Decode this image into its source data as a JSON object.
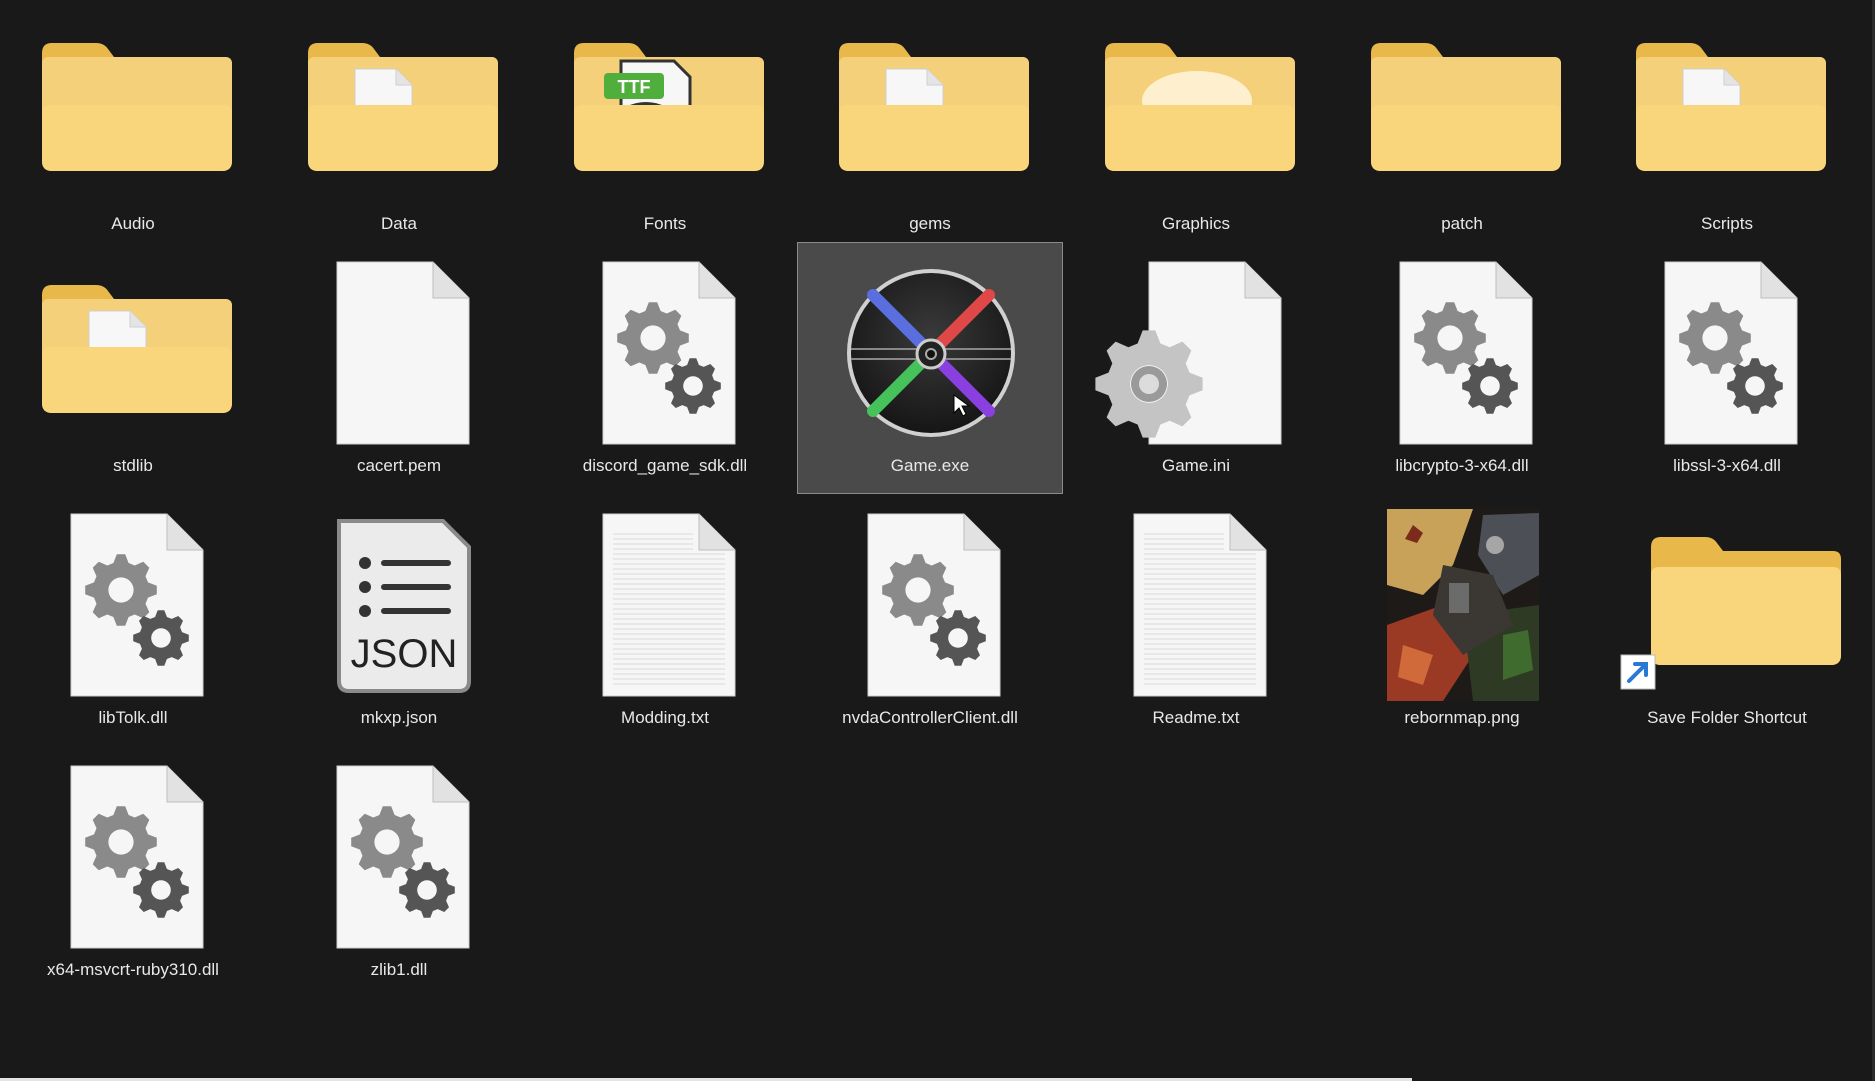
{
  "window": {
    "background": "#191919",
    "selected_background": "#4a4a4a"
  },
  "files": [
    {
      "name": "Audio",
      "type": "folder",
      "icon": "folder-icon",
      "overlay": "none"
    },
    {
      "name": "Data",
      "type": "folder",
      "icon": "folder-icon",
      "overlay": "doc"
    },
    {
      "name": "Fonts",
      "type": "folder",
      "icon": "folder-icon",
      "overlay": "ttf",
      "badge": "TTF"
    },
    {
      "name": "gems",
      "type": "folder",
      "icon": "folder-icon",
      "overlay": "doc"
    },
    {
      "name": "Graphics",
      "type": "folder",
      "icon": "folder-icon",
      "overlay": "glow"
    },
    {
      "name": "patch",
      "type": "folder",
      "icon": "folder-icon",
      "overlay": "none"
    },
    {
      "name": "Scripts",
      "type": "folder",
      "icon": "folder-icon",
      "overlay": "doc"
    },
    {
      "name": "stdlib",
      "type": "folder",
      "icon": "folder-icon",
      "overlay": "doc"
    },
    {
      "name": "cacert.pem",
      "type": "blank",
      "icon": "blank-file-icon"
    },
    {
      "name": "discord_game_sdk.dll",
      "type": "dll",
      "icon": "dll-file-icon"
    },
    {
      "name": "Game.exe",
      "type": "exe",
      "icon": "game-exe-icon",
      "selected": true
    },
    {
      "name": "Game.ini",
      "type": "ini",
      "icon": "ini-file-icon"
    },
    {
      "name": "libcrypto-3-x64.dll",
      "type": "dll",
      "icon": "dll-file-icon"
    },
    {
      "name": "libssl-3-x64.dll",
      "type": "dll",
      "icon": "dll-file-icon"
    },
    {
      "name": "libTolk.dll",
      "type": "dll",
      "icon": "dll-file-icon"
    },
    {
      "name": "mkxp.json",
      "type": "json",
      "icon": "json-file-icon",
      "badge": "JSON"
    },
    {
      "name": "Modding.txt",
      "type": "txt",
      "icon": "text-file-icon"
    },
    {
      "name": "nvdaControllerClient.dll",
      "type": "dll",
      "icon": "dll-file-icon"
    },
    {
      "name": "Readme.txt",
      "type": "txt",
      "icon": "text-file-icon"
    },
    {
      "name": "rebornmap.png",
      "type": "image",
      "icon": "image-thumbnail-icon"
    },
    {
      "name": "Save Folder Shortcut",
      "type": "shortcut",
      "icon": "folder-shortcut-icon"
    },
    {
      "name": "x64-msvcrt-ruby310.dll",
      "type": "dll",
      "icon": "dll-file-icon"
    },
    {
      "name": "zlib1.dll",
      "type": "dll",
      "icon": "dll-file-icon"
    }
  ]
}
